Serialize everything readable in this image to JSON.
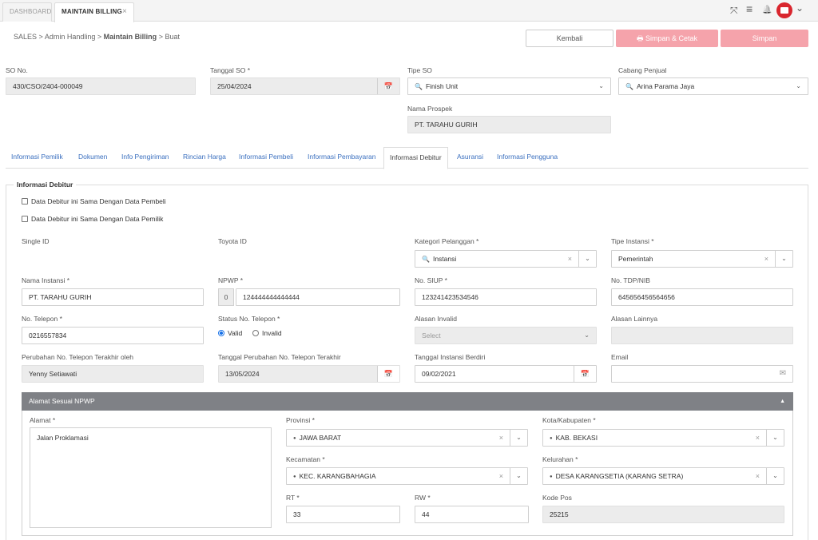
{
  "tabs": [
    {
      "label": "DASHBOARD"
    },
    {
      "label": "MAINTAIN BILLING",
      "close": "×"
    }
  ],
  "topbar": {
    "icons": [
      "expand-icon",
      "menu-icon",
      "bell-icon",
      "avatar",
      "chevron-down-icon"
    ],
    "expand_glyph": "⤧",
    "menu_glyph": "≡",
    "bell_glyph": "🔔",
    "chevron_glyph": "⌄"
  },
  "breadcrumb": {
    "items": [
      "SALES",
      "Admin Handling",
      "Maintain Billing",
      "Buat"
    ],
    "separator": ">"
  },
  "actions": {
    "back": "Kembali",
    "print": "Simpan & Cetak",
    "save": "Simpan"
  },
  "header_form": {
    "so_no": {
      "label": "SO No.",
      "value": "430/CSO/2404-000049"
    },
    "tanggal_so": {
      "label": "Tanggal SO *",
      "value": "25/04/2024"
    },
    "tipe_so": {
      "label": "Tipe SO",
      "value": "Finish Unit"
    },
    "cabang": {
      "label": "Cabang Penjual",
      "value": "Arina Parama Jaya"
    },
    "prospek": {
      "label": "Nama Prospek",
      "value": "PT. TARAHU GURIH"
    }
  },
  "section_tabs": [
    "Informasi Pemilik",
    "Dokumen",
    "Info Pengiriman",
    "Rincian Harga",
    "Informasi Pembeli",
    "Informasi Pembayaran",
    "Informasi Debitur",
    "Asuransi",
    "Informasi Pengguna"
  ],
  "active_tab": "Informasi Debitur",
  "debitur": {
    "legend": "Informasi Debitur",
    "check_pembeli": "Data Debitur ini Sama Dengan Data Pembeli",
    "check_pemilik": "Data Debitur ini Sama Dengan Data Pemilik",
    "single_id": {
      "label": "Single ID",
      "value": ""
    },
    "toyota_id": {
      "label": "Toyota ID",
      "value": ""
    },
    "kategori": {
      "label": "Kategori Pelanggan *",
      "value": "Instansi"
    },
    "tipe_instansi": {
      "label": "Tipe Instansi *",
      "value": "Pemerintah"
    },
    "nama_instansi": {
      "label": "Nama Instansi *",
      "value": "PT. TARAHU GURIH"
    },
    "npwp": {
      "label": "NPWP *",
      "prefix": "0",
      "value": "124444444444444"
    },
    "siup": {
      "label": "No. SIUP *",
      "value": "123241423534546"
    },
    "tdp": {
      "label": "No. TDP/NIB",
      "value": "645656456564656"
    },
    "telepon": {
      "label": "No. Telepon *",
      "value": "0216557834"
    },
    "status_telepon": {
      "label": "Status No. Telepon *",
      "valid": "Valid",
      "invalid": "Invalid"
    },
    "alasan_invalid": {
      "label": "Alasan Invalid",
      "placeholder": "Select"
    },
    "alasan_lainnya": {
      "label": "Alasan Lainnya",
      "value": ""
    },
    "perubahan_oleh": {
      "label": "Perubahan No. Telepon Terakhir oleh",
      "value": "Yenny Setiawati"
    },
    "tanggal_perubahan": {
      "label": "Tanggal Perubahan No. Telepon Terakhir",
      "value": "13/05/2024"
    },
    "tanggal_berdiri": {
      "label": "Tanggal Instansi Berdiri",
      "value": "09/02/2021"
    },
    "email": {
      "label": "Email",
      "value": ""
    }
  },
  "npwp_address": {
    "title": "Alamat Sesuai NPWP",
    "alamat": {
      "label": "Alamat *",
      "value": "Jalan Proklamasi"
    },
    "provinsi": {
      "label": "Provinsi *",
      "value": "JAWA BARAT"
    },
    "kota": {
      "label": "Kota/Kabupaten *",
      "value": "KAB. BEKASI"
    },
    "kecamatan": {
      "label": "Kecamatan *",
      "value": "KEC. KARANGBAHAGIA"
    },
    "kelurahan": {
      "label": "Kelurahan *",
      "value": "DESA KARANGSETIA (KARANG SETRA)"
    },
    "rt": {
      "label": "RT *",
      "value": "33"
    },
    "rw": {
      "label": "RW *",
      "value": "44"
    },
    "kode_pos": {
      "label": "Kode Pos",
      "value": "25215"
    }
  },
  "glyphs": {
    "search": "🔍",
    "calendar": "📅",
    "clear": "×",
    "caret": "⌄",
    "globe": "●",
    "mail": "✉",
    "up": "▲",
    "printer": "🖶"
  }
}
